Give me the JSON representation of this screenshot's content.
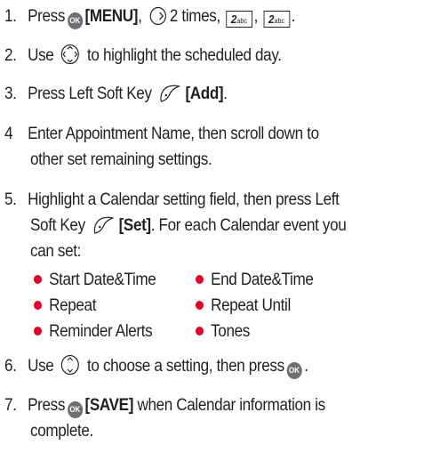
{
  "steps": {
    "s1": {
      "num": "1.",
      "t1": "Press",
      "ok": "OK",
      "menu": "[MENU]",
      "t2": "2 times,",
      "key": "2",
      "key_sub": "abc",
      "comma": ","
    },
    "s2": {
      "num": "2.",
      "t1": "Use",
      "t2": "to highlight the scheduled day."
    },
    "s3": {
      "num": "3.",
      "t1": "Press Left Soft Key",
      "add": "[Add]",
      "end": "."
    },
    "s4": {
      "num": "4",
      "line1": "Enter Appointment Name, then scroll down to",
      "line2": "other set remaining settings."
    },
    "s5": {
      "num": "5.",
      "line1": "Highlight a Calendar setting field, then press Left",
      "t1": "Soft Key",
      "set": "[Set]",
      "t2": ". For each Calendar event you",
      "line3": "can set:"
    },
    "s6": {
      "num": "6.",
      "t1": "Use",
      "t2": "to choose a setting, then press",
      "end": "."
    },
    "s7": {
      "num": "7.",
      "t1": "Press",
      "save": "[SAVE]",
      "t2": "when Calendar information is",
      "line2": "complete."
    }
  },
  "options": [
    "Start Date&Time",
    "End Date&Time",
    "Repeat",
    "Repeat Until",
    "Reminder Alerts",
    "Tones"
  ],
  "colors": {
    "bullet": "#e4002b",
    "ok_icon": "#6d6e71",
    "text": "#231f20"
  },
  "icons": [
    "ok-key-icon",
    "navigation-right-icon",
    "navigation-all-icon",
    "left-soft-key-icon",
    "navigation-up-down-icon",
    "number-key-2-icon"
  ]
}
